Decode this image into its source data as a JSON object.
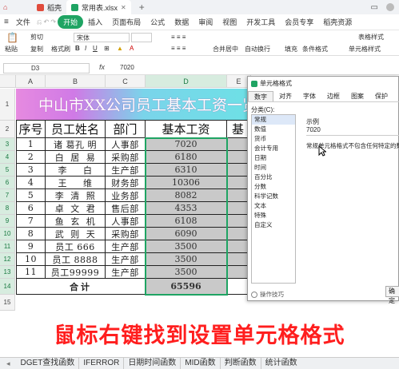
{
  "titlebar": {
    "tabs": [
      {
        "label": "稻壳",
        "color": "#e04b3c"
      },
      {
        "label": "常用表.xlsx",
        "color": "#1fa463"
      }
    ]
  },
  "menu": {
    "items": [
      "文件",
      "开始",
      "插入",
      "页面布局",
      "公式",
      "数据",
      "审阅",
      "视图",
      "开发工具",
      "会员专享",
      "稻壳资源"
    ],
    "active_index": 1,
    "accent": "#1fa463"
  },
  "ribbon": {
    "paste_label": "粘贴",
    "cut_label": "剪切",
    "copy_label": "复制",
    "format_painter_label": "格式刷",
    "font_name": "宋体",
    "fill_label": "填充",
    "merge_label": "合并居中",
    "wrap_label": "自动换行",
    "cond_format_label": "条件格式",
    "cell_style_label": "单元格样式",
    "table_style_label": "表格样式"
  },
  "formula_bar": {
    "cell_ref": "D3",
    "fx": "fx",
    "value": "7020"
  },
  "columns": [
    "A",
    "B",
    "C",
    "D",
    "E"
  ],
  "selected_column": "D",
  "table": {
    "title": "中山市XX公司员工基本工资一览",
    "headers": [
      "序号",
      "员工姓名",
      "部门",
      "基本工资",
      "基"
    ],
    "rows": [
      {
        "num": "3",
        "seq": "1",
        "name": "诸 葛孔 明",
        "dept": "人事部",
        "salary": "7020"
      },
      {
        "num": "4",
        "seq": "2",
        "name": "白  居  易",
        "dept": "采购部",
        "salary": "6180"
      },
      {
        "num": "5",
        "seq": "3",
        "name": "李     白",
        "dept": "生产部",
        "salary": "6310"
      },
      {
        "num": "6",
        "seq": "4",
        "name": "王     维",
        "dept": "财务部",
        "salary": "10306"
      },
      {
        "num": "7",
        "seq": "5",
        "name": "李  清  照",
        "dept": "业务部",
        "salary": "8082"
      },
      {
        "num": "8",
        "seq": "6",
        "name": "卓  文  君",
        "dept": "售后部",
        "salary": "4353"
      },
      {
        "num": "9",
        "seq": "7",
        "name": "鱼  玄  机",
        "dept": "人事部",
        "salary": "6108"
      },
      {
        "num": "10",
        "seq": "8",
        "name": "武  则  天",
        "dept": "采购部",
        "salary": "6090"
      },
      {
        "num": "11",
        "seq": "9",
        "name": "员工 666",
        "dept": "生产部",
        "salary": "3500"
      },
      {
        "num": "12",
        "seq": "10",
        "name": "员工 8888",
        "dept": "生产部",
        "salary": "3500"
      },
      {
        "num": "13",
        "seq": "11",
        "name": "员工99999",
        "dept": "生产部",
        "salary": "3500"
      }
    ],
    "total_label": "合计",
    "total_value": "65596",
    "title_row_num": "1",
    "header_row_num": "2",
    "total_row_num": "14",
    "empty_row_num": "15"
  },
  "dialog": {
    "title": "单元格格式",
    "tabs": [
      "数字",
      "对齐",
      "字体",
      "边框",
      "图案",
      "保护"
    ],
    "active_tab": 0,
    "category_label": "分类(C):",
    "categories": [
      "常规",
      "数值",
      "货币",
      "会计专用",
      "日期",
      "时间",
      "百分比",
      "分数",
      "科学记数",
      "文本",
      "特殊",
      "自定义"
    ],
    "selected_category": 0,
    "sample_label": "示例",
    "sample_value": "7020",
    "description": "常规单元格格式不包含任何特定的数字",
    "tips_label": "操作技巧",
    "ok_label": "确定"
  },
  "caption": "鼠标右键找到设置单元格格式",
  "sheet_tabs": [
    "DGET查找函数",
    "IFERROR",
    "日期时间函数",
    "MID函数",
    "判断函数",
    "统计函数"
  ]
}
